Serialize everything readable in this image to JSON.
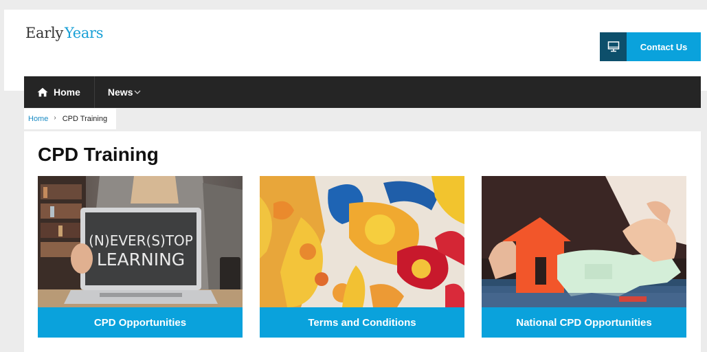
{
  "logo": {
    "part1": "Early",
    "part2": "Years"
  },
  "header": {
    "contact_label": "Contact Us"
  },
  "nav": {
    "home_label": "Home",
    "news_label": "News"
  },
  "breadcrumb": {
    "home": "Home",
    "current": "CPD Training"
  },
  "main": {
    "title": "CPD Training",
    "cards": [
      {
        "label": "CPD Opportunities",
        "image_text_line1": "(N)EVER(S)TOP",
        "image_text_line2": "LEARNING"
      },
      {
        "label": "Terms and Conditions"
      },
      {
        "label": "National CPD Opportunities"
      }
    ]
  },
  "colors": {
    "accent": "#0aa2dc",
    "dark_accent": "#0d4f6b",
    "nav_bg": "#252525",
    "logo_blue": "#1aa0d6"
  }
}
